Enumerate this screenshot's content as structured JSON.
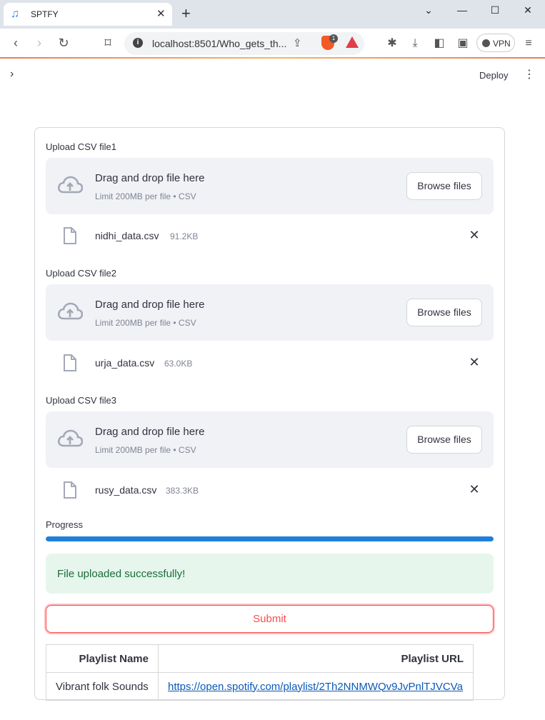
{
  "browser": {
    "tab_title": "SPTFY",
    "tab_close": "✕",
    "new_tab": "+",
    "url": "localhost:8501/Who_gets_th...",
    "brave_badge": "1",
    "vpn_label": "VPN",
    "window_controls": {
      "minimize": "—",
      "maximize": "☐",
      "close": "✕",
      "dropdown": "⌄"
    }
  },
  "header": {
    "sidebar_toggle": "›",
    "deploy_label": "Deploy",
    "menu_icon": "⋮"
  },
  "uploaders": [
    {
      "label": "Upload CSV file1",
      "drop_title": "Drag and drop file here",
      "limit": "Limit 200MB per file • CSV",
      "browse_label": "Browse files",
      "file_name": "nidhi_data.csv",
      "file_size": "91.2KB"
    },
    {
      "label": "Upload CSV file2",
      "drop_title": "Drag and drop file here",
      "limit": "Limit 200MB per file • CSV",
      "browse_label": "Browse files",
      "file_name": "urja_data.csv",
      "file_size": "63.0KB"
    },
    {
      "label": "Upload CSV file3",
      "drop_title": "Drag and drop file here",
      "limit": "Limit 200MB per file • CSV",
      "browse_label": "Browse files",
      "file_name": "rusy_data.csv",
      "file_size": "383.3KB"
    }
  ],
  "progress": {
    "label": "Progress",
    "value": 1.0
  },
  "success_message": "File uploaded successfully!",
  "submit_label": "Submit",
  "results_table": {
    "headers": [
      "Playlist Name",
      "Playlist URL"
    ],
    "rows": [
      [
        "Vibrant folk Sounds",
        "https://open.spotify.com/playlist/2Th2NNMWQv9JvPnlTJVCVa"
      ]
    ]
  },
  "colors": {
    "accent": "#ff4b4b",
    "progress": "#1f7fdb",
    "success_bg": "#e6f6ec",
    "success_text": "#1a6d3a",
    "link": "#0b59b8"
  },
  "icons": {
    "upload": "cloud-upload-icon",
    "file": "file-icon",
    "remove": "close-icon"
  }
}
